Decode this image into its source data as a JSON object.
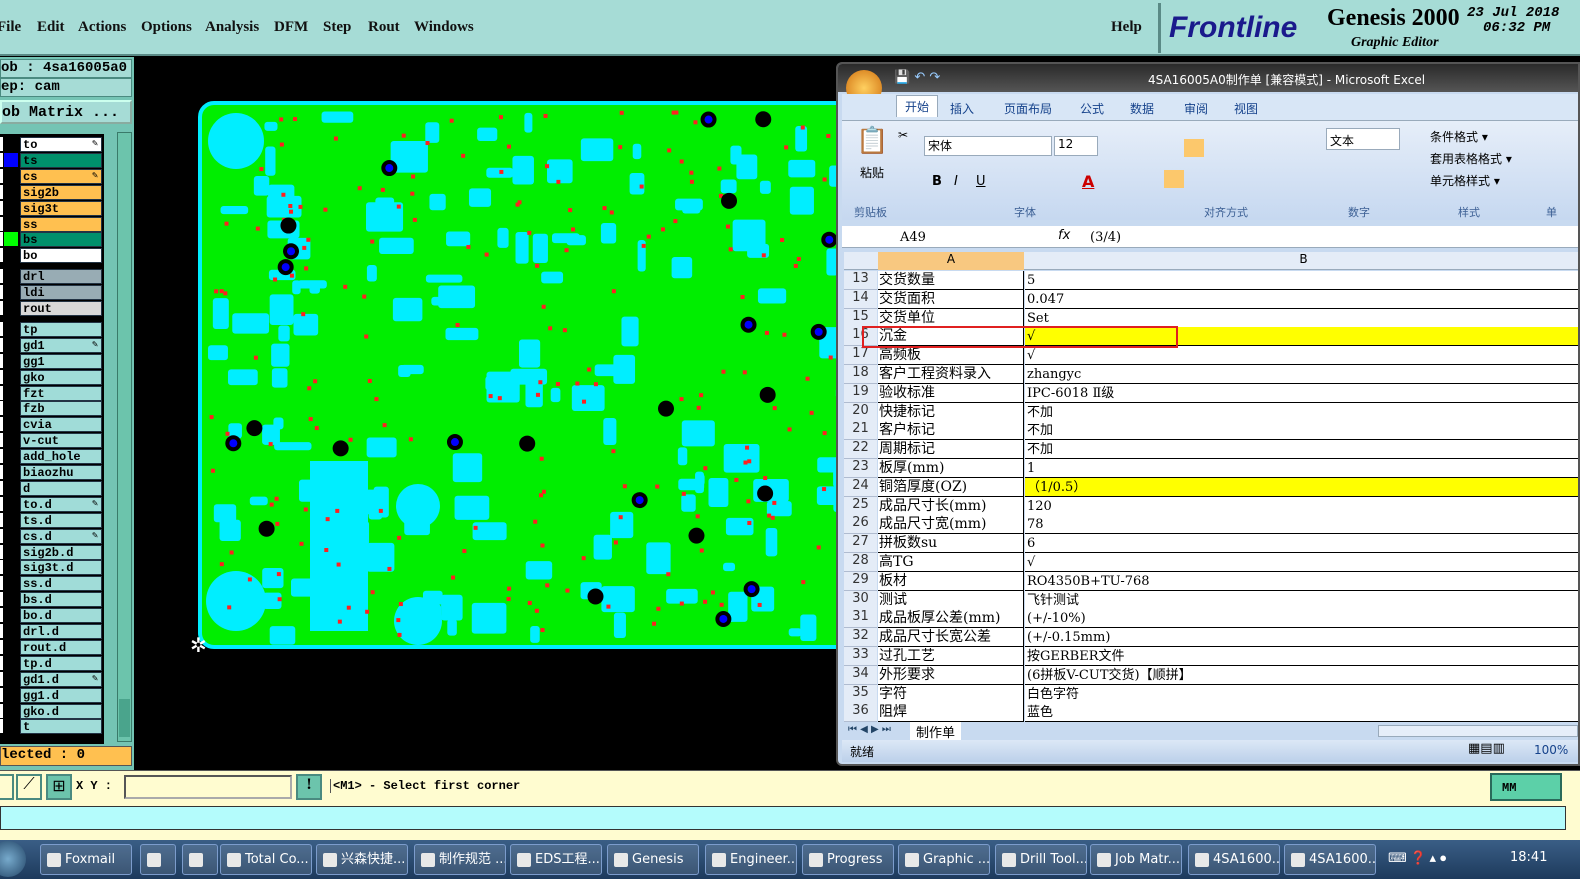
{
  "menu": [
    "File",
    "Edit",
    "Actions",
    "Options",
    "Analysis",
    "DFM",
    "Step",
    "Rout",
    "Windows",
    "Help"
  ],
  "logo": {
    "brand": "Frontline",
    "product": "Genesis 2000",
    "subtitle": "Graphic Editor",
    "date": "23 Jul 2018",
    "time": "06:32 PM"
  },
  "left": {
    "job": "ob : 4sa16005a0",
    "step": "ep: cam",
    "job_matrix": "ob Matrix ...",
    "selected": "lected : 0",
    "layers": [
      {
        "name": "to",
        "bg": "#ffffff",
        "ptr": true
      },
      {
        "name": "ts",
        "bg": "#00906c",
        "swatch": "#0000ff"
      },
      {
        "name": "cs",
        "bg": "#ffc050",
        "ptr": true
      },
      {
        "name": "sig2b",
        "bg": "#ffc050"
      },
      {
        "name": "sig3t",
        "bg": "#ffc050"
      },
      {
        "name": "ss",
        "bg": "#ffc050"
      },
      {
        "name": "bs",
        "bg": "#00906c",
        "swatch": "#00ff00"
      },
      {
        "name": "bo",
        "bg": "#ffffff"
      },
      {
        "name": "drl",
        "bg": "#98acb4",
        "gap": true
      },
      {
        "name": "ldi",
        "bg": "#98acb4"
      },
      {
        "name": "rout",
        "bg": "#d8d8d8"
      },
      {
        "name": "tp",
        "bg": "#a0dcd8",
        "gap": true
      },
      {
        "name": "gd1",
        "bg": "#a0dcd8",
        "ptr": true
      },
      {
        "name": "gg1",
        "bg": "#a0dcd8"
      },
      {
        "name": "gko",
        "bg": "#a0dcd8"
      },
      {
        "name": "fzt",
        "bg": "#a0dcd8"
      },
      {
        "name": "fzb",
        "bg": "#a0dcd8"
      },
      {
        "name": "cvia",
        "bg": "#a0dcd8"
      },
      {
        "name": "v-cut",
        "bg": "#a0dcd8"
      },
      {
        "name": "add_hole",
        "bg": "#a0dcd8"
      },
      {
        "name": "biaozhu",
        "bg": "#a0dcd8"
      },
      {
        "name": "d",
        "bg": "#a0dcd8"
      },
      {
        "name": "to.d",
        "bg": "#a0dcd8",
        "ptr": true
      },
      {
        "name": "ts.d",
        "bg": "#a0dcd8"
      },
      {
        "name": "cs.d",
        "bg": "#a0dcd8",
        "ptr": true
      },
      {
        "name": "sig2b.d",
        "bg": "#a0dcd8"
      },
      {
        "name": "sig3t.d",
        "bg": "#a0dcd8"
      },
      {
        "name": "ss.d",
        "bg": "#a0dcd8"
      },
      {
        "name": "bs.d",
        "bg": "#a0dcd8"
      },
      {
        "name": "bo.d",
        "bg": "#a0dcd8"
      },
      {
        "name": "drl.d",
        "bg": "#a0dcd8"
      },
      {
        "name": "rout.d",
        "bg": "#a0dcd8"
      },
      {
        "name": "tp.d",
        "bg": "#a0dcd8"
      },
      {
        "name": "gd1.d",
        "bg": "#a0dcd8",
        "ptr": true
      },
      {
        "name": "gg1.d",
        "bg": "#a0dcd8"
      },
      {
        "name": "gko.d",
        "bg": "#a0dcd8"
      },
      {
        "name": "t",
        "bg": "#a0dcd8"
      }
    ]
  },
  "excel": {
    "title": "4SA16005A0制作单  [兼容模式] - Microsoft Excel",
    "tabs": [
      "开始",
      "插入",
      "页面布局",
      "公式",
      "数据",
      "审阅",
      "视图"
    ],
    "paste": "粘贴",
    "font": "宋体",
    "size": "12",
    "number_format": "文本",
    "styles": [
      "条件格式 ▾",
      "套用表格格式 ▾",
      "单元格样式 ▾"
    ],
    "groups": [
      "剪贴板",
      "字体",
      "对齐方式",
      "数字",
      "样式",
      "单"
    ],
    "name_box": "A49",
    "formula": "(3/4)",
    "col_a": "A",
    "col_b": "B",
    "rows": [
      {
        "n": "13",
        "a": "交货数量",
        "b": "5"
      },
      {
        "n": "14",
        "a": "交货面积",
        "b": "0.047"
      },
      {
        "n": "15",
        "a": "交货单位",
        "b": "Set"
      },
      {
        "n": "16",
        "a": "沉金",
        "b": "√",
        "hl": true
      },
      {
        "n": "17",
        "a": "高频板",
        "b": "√"
      },
      {
        "n": "18",
        "a": "客户工程资料录入",
        "b": "zhangyc"
      },
      {
        "n": "19",
        "a": "验收标准",
        "b": "IPC-6018 Ⅱ级"
      },
      {
        "n": "20",
        "a": "快捷标记",
        "b": "不加"
      },
      {
        "n": "21",
        "a": "客户标记",
        "b": "不加"
      },
      {
        "n": "22",
        "a": "周期标记",
        "b": "不加"
      },
      {
        "n": "23",
        "a": "板厚(mm)",
        "b": "1"
      },
      {
        "n": "24",
        "a": "铜箔厚度(OZ)",
        "b": "（1/0.5）",
        "hl": true
      },
      {
        "n": "25",
        "a": "成品尺寸长(mm)",
        "b": "120"
      },
      {
        "n": "26",
        "a": "成品尺寸宽(mm)",
        "b": "78"
      },
      {
        "n": "27",
        "a": "拼板数su",
        "b": "6"
      },
      {
        "n": "28",
        "a": "高TG",
        "b": "√"
      },
      {
        "n": "29",
        "a": "板材",
        "b": "RO4350B+TU-768"
      },
      {
        "n": "30",
        "a": "测试",
        "b": "飞针测试"
      },
      {
        "n": "31",
        "a": "成品板厚公差(mm)",
        "b": "(+/-10%)"
      },
      {
        "n": "32",
        "a": "成品尺寸长宽公差",
        "b": "(+/-0.15mm)"
      },
      {
        "n": "33",
        "a": "过孔工艺",
        "b": "按GERBER文件"
      },
      {
        "n": "34",
        "a": "外形要求",
        "b": "(6拼板V-CUT交货)【顺拼】"
      },
      {
        "n": "35",
        "a": "字符",
        "b": "白色字符"
      },
      {
        "n": "36",
        "a": "阻焊",
        "b": "蓝色"
      }
    ],
    "sheet_tab": "制作单",
    "status": "就绪",
    "zoom": "100%"
  },
  "statusbar": {
    "xy_label": "X Y :",
    "xy_value": "",
    "prompt": "<M1> - Select first corner",
    "units": "MM"
  },
  "taskbar": {
    "items": [
      "Foxmail",
      "",
      "",
      "Total Co...",
      "兴森快捷...",
      "制作规范 ...",
      "EDS工程...",
      "Genesis",
      "Engineer...",
      "Progress",
      "Graphic ...",
      "Drill Tool...",
      "Job Matr...",
      "4SA1600...",
      "4SA1600..."
    ],
    "clock": "18:41"
  },
  "colors": {
    "board": "#00ee00",
    "pad": "#00eeff",
    "drill": "#ff2020",
    "highlight": "#ffff00"
  }
}
